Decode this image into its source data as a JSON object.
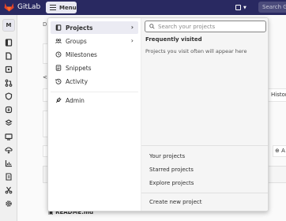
{
  "navbar": {
    "brand": "GitLab",
    "menu_label": "Menu",
    "search_placeholder": "Search Gi"
  },
  "sidebar": {
    "avatar_letter": "M",
    "icons": [
      "project-icon",
      "repository-icon",
      "issues-icon",
      "merge-requests-icon",
      "security-icon",
      "deployments-icon",
      "infrastructure-icon",
      "monitor-icon",
      "packages-icon",
      "analytics-icon",
      "wiki-icon",
      "snippets-icon",
      "settings-icon"
    ]
  },
  "background": {
    "crumb": "D",
    "history_label": "Histor",
    "readme_label": "README.md"
  },
  "menu": {
    "items": [
      {
        "label": "Projects",
        "icon": "project-icon",
        "has_chevron": true,
        "active": true
      },
      {
        "label": "Groups",
        "icon": "group-icon",
        "has_chevron": true,
        "active": false
      },
      {
        "label": "Milestones",
        "icon": "clock-icon",
        "has_chevron": false,
        "active": false
      },
      {
        "label": "Snippets",
        "icon": "snippet-icon",
        "has_chevron": false,
        "active": false
      },
      {
        "label": "Activity",
        "icon": "history-icon",
        "has_chevron": false,
        "active": false
      }
    ],
    "admin_label": "Admin",
    "search_placeholder": "Search your projects",
    "frequently_visited": "Frequently visited",
    "empty_note": "Projects you visit often will appear here",
    "links": {
      "your_projects": "Your projects",
      "starred_projects": "Starred projects",
      "explore_projects": "Explore projects",
      "create_new_project": "Create new project"
    }
  }
}
